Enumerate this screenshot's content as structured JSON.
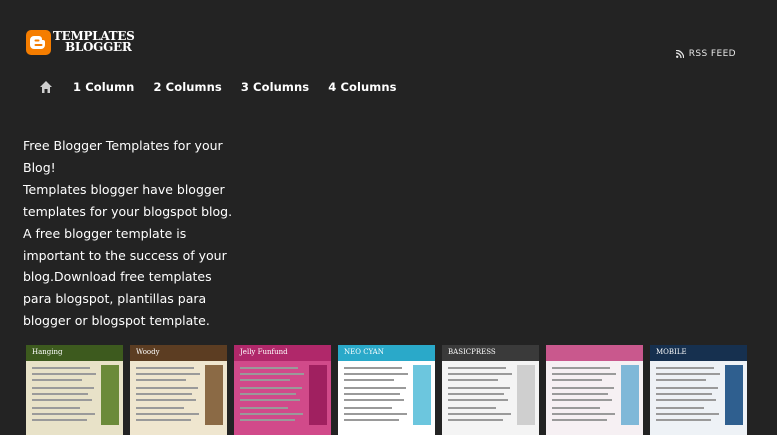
{
  "header": {
    "logo": {
      "line1": "TEMPLATES",
      "line2": "BLOGGER",
      "icon": "blogger-icon",
      "brand_color": "#f57d00"
    },
    "rss_label": "RSS FEED",
    "rss_icon": "rss-icon"
  },
  "nav": {
    "home_icon": "home-icon",
    "items": [
      {
        "label": "1 Column"
      },
      {
        "label": "2 Columns"
      },
      {
        "label": "3 Columns"
      },
      {
        "label": "4 Columns"
      }
    ]
  },
  "intro": {
    "lines": [
      "Free Blogger Templates for your",
      "Blog!",
      "Templates blogger have blogger",
      "templates for your blogspot blog.",
      "A free blogger template is",
      "important to the success of your",
      "blog.Download free templates",
      "para blogspot, plantillas para",
      "blogger or blogspot template."
    ]
  },
  "thumbnails": [
    {
      "title": "Hanging",
      "top_color": "#3d5a1e",
      "body_color": "#e8e2c8",
      "side_color": "#6b8a3a"
    },
    {
      "title": "Woody",
      "top_color": "#5c3d22",
      "body_color": "#efe6cf",
      "side_color": "#8b6a45"
    },
    {
      "title": "Jelly Funfund",
      "top_color": "#b0286a",
      "body_color": "#d14a8a",
      "side_color": "#a02060"
    },
    {
      "title": "NEO CYAN",
      "top_color": "#2aa9c9",
      "body_color": "#ffffff",
      "side_color": "#6cc6de"
    },
    {
      "title": "BASICPRESS",
      "top_color": "#3a3a3a",
      "body_color": "#f4f4f4",
      "side_color": "#cfcfcf"
    },
    {
      "title": "",
      "top_color": "#c9588d",
      "body_color": "#f6f0f3",
      "side_color": "#7fb8d8"
    },
    {
      "title": "MOBILE",
      "top_color": "#16304f",
      "body_color": "#eef2f6",
      "side_color": "#2f5f8f"
    }
  ]
}
